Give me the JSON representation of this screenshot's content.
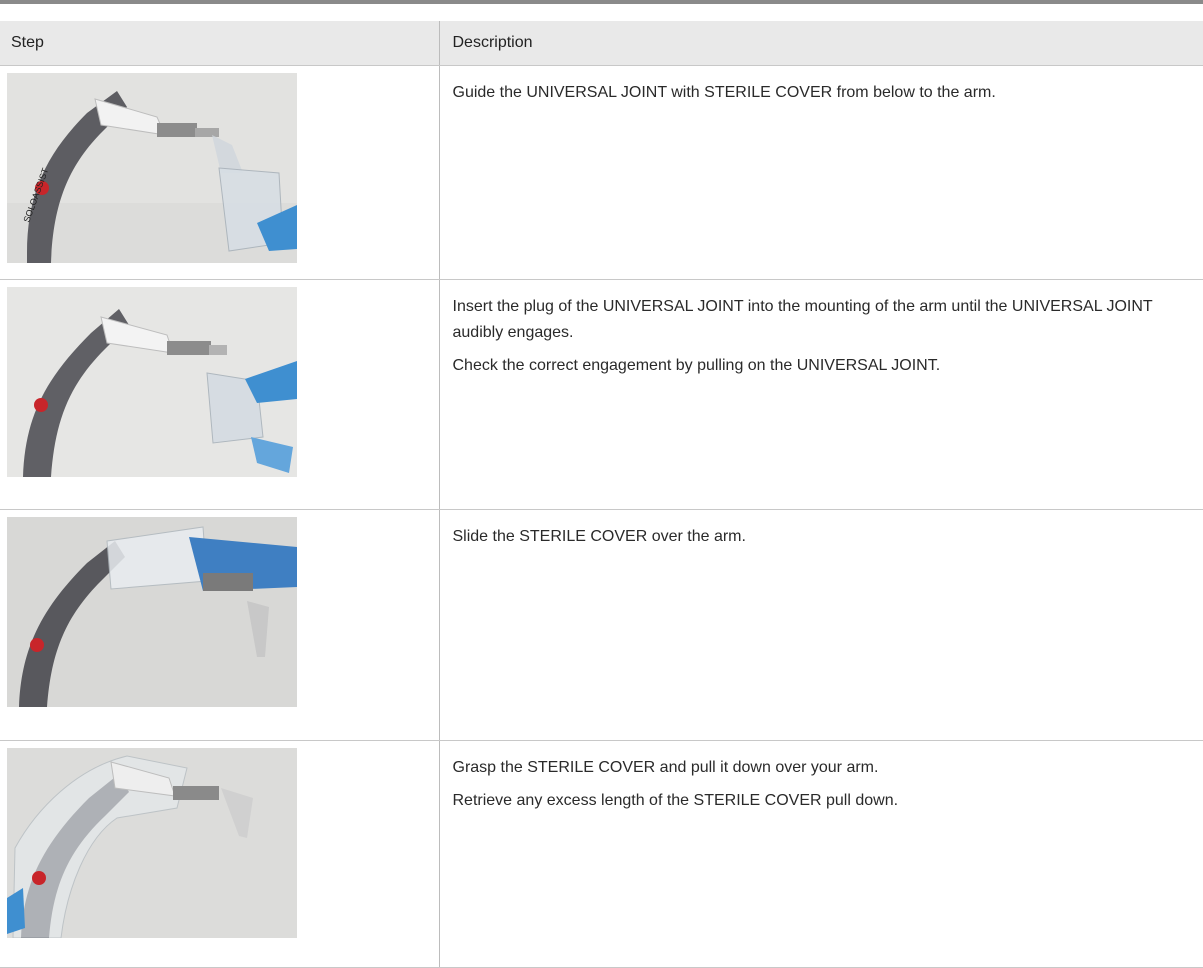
{
  "table": {
    "headers": [
      "Step",
      "Description"
    ],
    "rows": [
      {
        "image": "photo of SOLOASSIST arm with universal joint and sterile cover approached from below",
        "paragraphs": [
          "Guide the UNIVERSAL JOINT with STERILE COVER from below to the arm."
        ]
      },
      {
        "image": "photo of plug being inserted into arm mounting",
        "paragraphs": [
          "Insert the plug of the UNIVERSAL JOINT into the mounting of the arm until the UNIVERSAL JOINT audibly engages.",
          "Check the correct engagement by pulling on the UNIVERSAL JOINT."
        ]
      },
      {
        "image": "photo of sterile cover sliding over the arm",
        "paragraphs": [
          "Slide the STERILE COVER over the arm."
        ]
      },
      {
        "image": "photo of sterile cover pulled down over the arm",
        "paragraphs": [
          "Grasp the STERILE COVER and pull it down over your arm.",
          "Retrieve any excess length of the STERILE COVER pull down."
        ]
      }
    ]
  },
  "device_label": "SOLOASSIST",
  "colors": {
    "arm": "#5f5f63",
    "glove": "#3f8fd0",
    "wall": "#e4e4e4",
    "button": "#c8252a"
  }
}
